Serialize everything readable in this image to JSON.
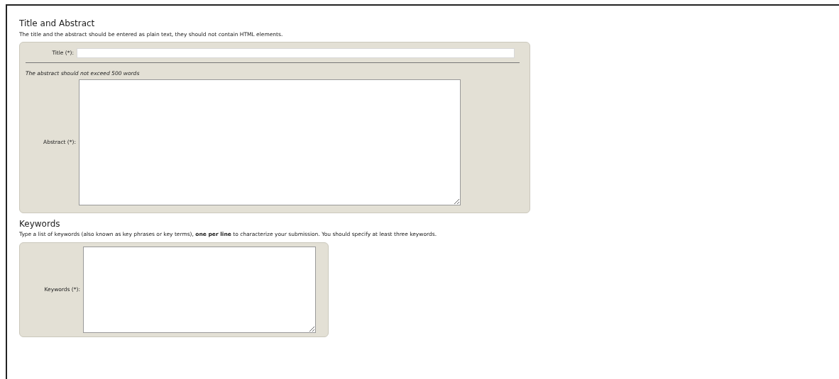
{
  "sections": [
    {
      "heading": "Title and Abstract",
      "description": "The title and the abstract should be entered as plain text, they should not contain HTML elements.",
      "title_field": {
        "label": "Title (*):"
      },
      "note": "The abstract should not exceed 500 words",
      "abstract_field": {
        "label": "Abstract (*):"
      }
    },
    {
      "heading": "Keywords",
      "description": "Type a list of keywords (also known as key phrases or key terms), **one per line** to characterize your submission. You should specify at least three keywords.",
      "keywords_field": {
        "label": "Keywords (*):"
      }
    }
  ]
}
